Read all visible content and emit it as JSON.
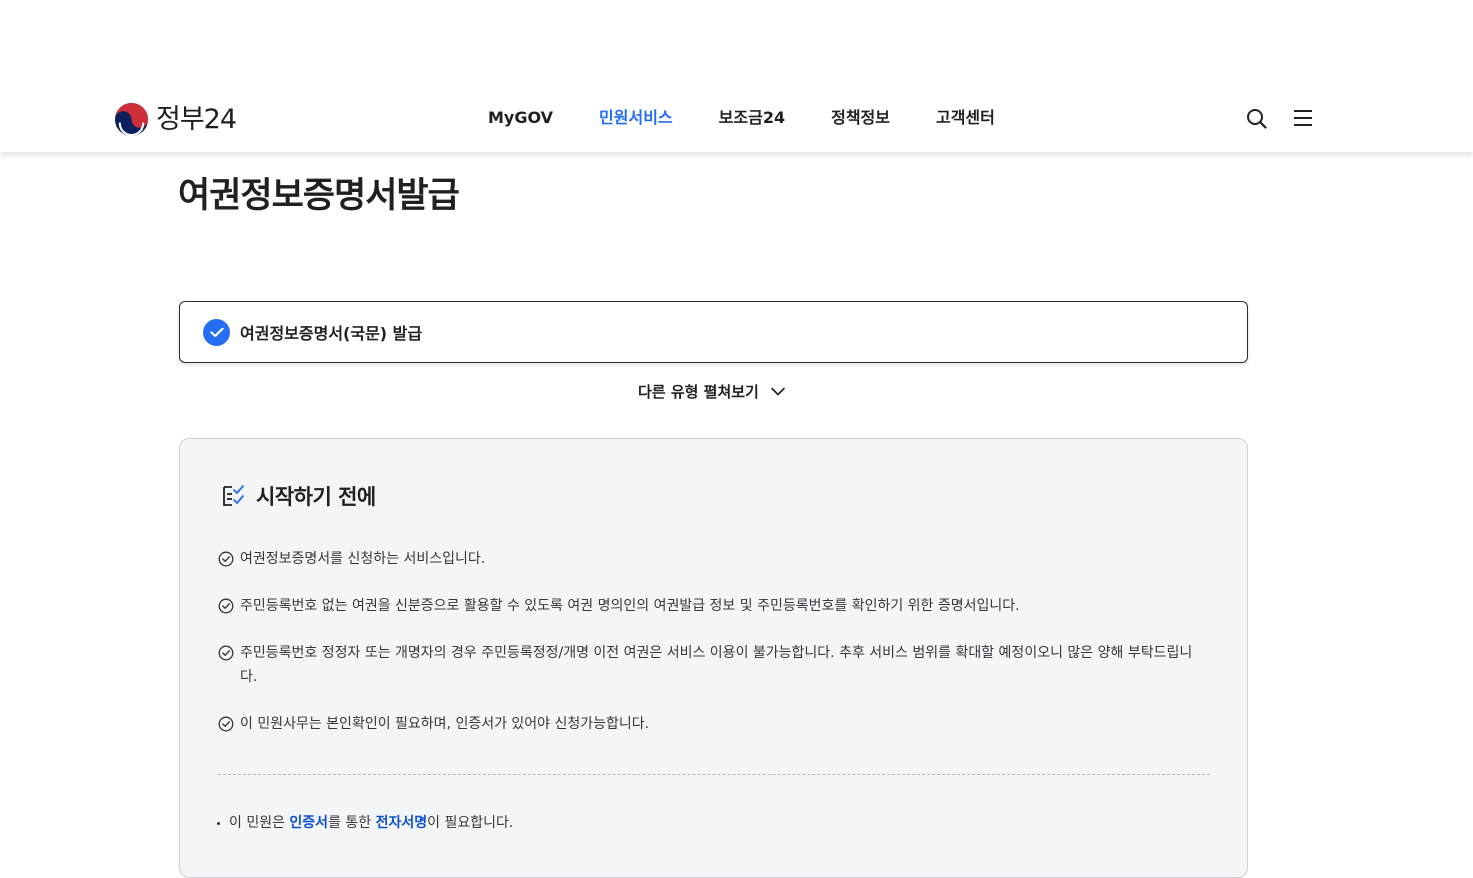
{
  "header": {
    "logo_text": "정부24",
    "nav": [
      {
        "label": "MyGOV",
        "active": false
      },
      {
        "label": "민원서비스",
        "active": true
      },
      {
        "label": "보조금24",
        "active": false
      },
      {
        "label": "정책정보",
        "active": false
      },
      {
        "label": "고객센터",
        "active": false
      }
    ],
    "icons": [
      "search-icon",
      "menu-icon"
    ]
  },
  "page": {
    "title": "여권정보증명서발급",
    "selected_type": "여권정보증명서(국문) 발급",
    "expand_label": "다른 유형 펼쳐보기"
  },
  "before_start": {
    "title": "시작하기 전에",
    "items": [
      "여권정보증명서를 신청하는 서비스입니다.",
      "주민등록번호 없는 여권을 신분증으로 활용할 수 있도록 여권 명의인의 여권발급 정보 및 주민등록번호를 확인하기 위한 증명서입니다.",
      "주민등록번호 정정자 또는 개명자의 경우 주민등록정정/개명 이전 여권은 서비스 이용이 불가능합니다. 추후 서비스 범위를 확대할 예정이오니 많은 양해 부탁드립니다.",
      "이 민원사무는 본인확인이 필요하며, 인증서가 있어야 신청가능합니다."
    ],
    "note": {
      "prefix": "이 민원은 ",
      "highlight1": "인증서",
      "middle": "를 통한 ",
      "highlight2": "전자서명",
      "suffix": "이 필요합니다."
    }
  },
  "colors": {
    "accent": "#256ef4",
    "text": "#1e2124",
    "highlight": "#0b50d0",
    "panel_bg": "#f4f5f6"
  }
}
